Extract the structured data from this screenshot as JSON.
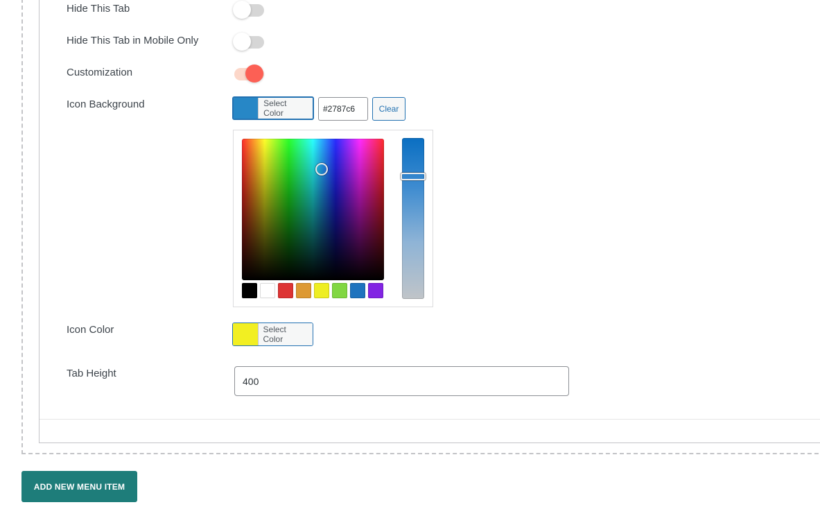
{
  "fields": {
    "hide_tab": {
      "label": "Hide This Tab",
      "on": false
    },
    "hide_mobile": {
      "label": "Hide This Tab in Mobile Only",
      "on": false
    },
    "customization": {
      "label": "Customization",
      "on": true
    },
    "icon_background": {
      "label": "Icon Background",
      "select_label": "Select Color",
      "hex_value": "#2787c6",
      "clear_label": "Clear",
      "swatch_color": "#2787c6"
    },
    "icon_color": {
      "label": "Icon Color",
      "select_label": "Select Color",
      "swatch_color": "#f2ef22"
    },
    "tab_height": {
      "label": "Tab Height",
      "value": "400"
    }
  },
  "color_picker": {
    "palette": [
      "#000000",
      "#ffffff",
      "#dd3333",
      "#dd9933",
      "#eeee22",
      "#81d742",
      "#1e73be",
      "#8224e3"
    ]
  },
  "actions": {
    "add_menu_item_label": "ADD NEW MENU ITEM"
  }
}
